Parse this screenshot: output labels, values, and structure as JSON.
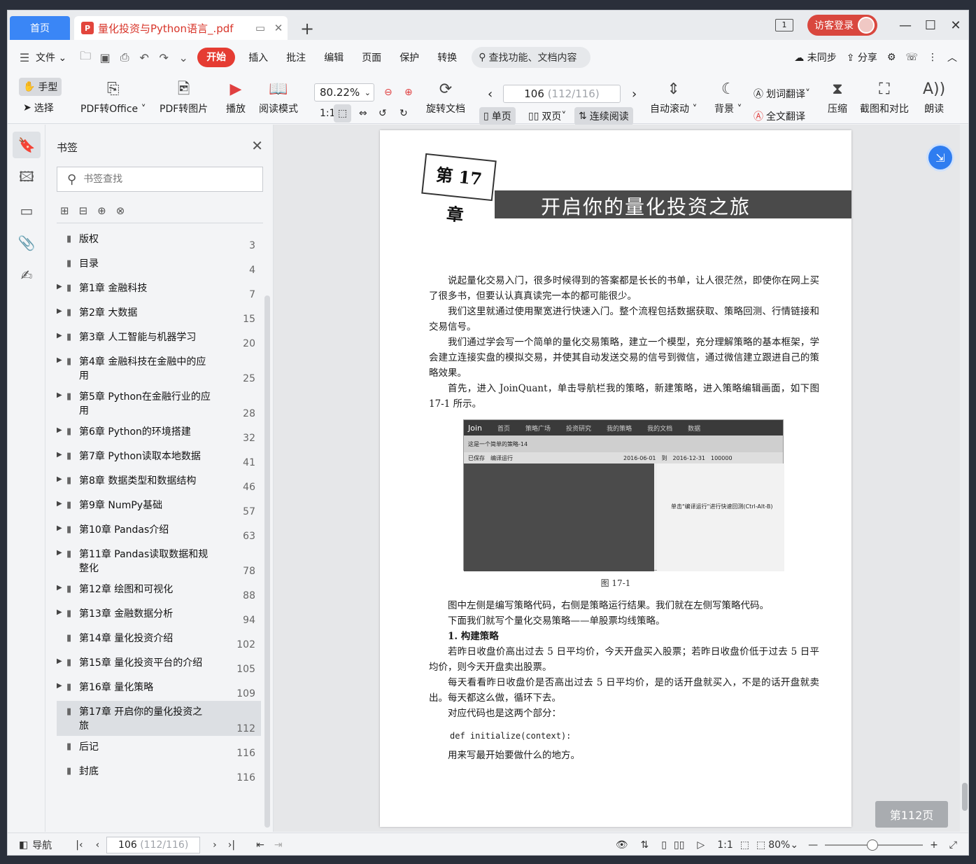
{
  "tabs": {
    "home": "首页",
    "doc_title": "量化投资与Python语言_.pdf"
  },
  "titlebar": {
    "screen_badge": "1",
    "login": "访客登录"
  },
  "menu": {
    "file": "文件",
    "items": [
      "开始",
      "插入",
      "批注",
      "编辑",
      "页面",
      "保护",
      "转换"
    ],
    "search": "查找功能、文档内容",
    "sync": "未同步",
    "share": "分享"
  },
  "toolbar": {
    "hand": "手型",
    "select": "选择",
    "pdf_office": "PDF转Office",
    "pdf_image": "PDF转图片",
    "play": "播放",
    "read_mode": "阅读模式",
    "zoom": "80.22%",
    "rotate": "旋转文档",
    "page_current": "106",
    "page_total": "(112/116)",
    "single": "单页",
    "double": "双页",
    "continuous": "连续阅读",
    "autoscroll": "自动滚动",
    "background": "背景",
    "word_translate": "划词翻译",
    "full_translate": "全文翻译",
    "compress": "压缩",
    "screenshot_compare": "截图和对比",
    "read_aloud": "朗读"
  },
  "bookmarks": {
    "title": "书签",
    "search_placeholder": "书签查找",
    "items": [
      {
        "label": "版权",
        "page": "3",
        "expandable": false,
        "selected": false
      },
      {
        "label": "目录",
        "page": "4",
        "expandable": false,
        "selected": false
      },
      {
        "label": "第1章 金融科技",
        "page": "7",
        "expandable": true,
        "selected": false
      },
      {
        "label": "第2章 大数据",
        "page": "15",
        "expandable": true,
        "selected": false
      },
      {
        "label": "第3章 人工智能与机器学习",
        "page": "20",
        "expandable": true,
        "selected": false
      },
      {
        "label": "第4章 金融科技在金融中的应用",
        "page": "25",
        "expandable": true,
        "selected": false
      },
      {
        "label": "第5章 Python在金融行业的应用",
        "page": "28",
        "expandable": true,
        "selected": false
      },
      {
        "label": "第6章 Python的环境搭建",
        "page": "32",
        "expandable": true,
        "selected": false
      },
      {
        "label": "第7章 Python读取本地数据",
        "page": "41",
        "expandable": true,
        "selected": false
      },
      {
        "label": "第8章 数据类型和数据结构",
        "page": "46",
        "expandable": true,
        "selected": false
      },
      {
        "label": "第9章 NumPy基础",
        "page": "57",
        "expandable": true,
        "selected": false
      },
      {
        "label": "第10章 Pandas介绍",
        "page": "63",
        "expandable": true,
        "selected": false
      },
      {
        "label": "第11章 Pandas读取数据和规整化",
        "page": "78",
        "expandable": true,
        "selected": false
      },
      {
        "label": "第12章 绘图和可视化",
        "page": "88",
        "expandable": true,
        "selected": false
      },
      {
        "label": "第13章 金融数据分析",
        "page": "94",
        "expandable": true,
        "selected": false
      },
      {
        "label": "第14章 量化投资介绍",
        "page": "102",
        "expandable": false,
        "selected": false
      },
      {
        "label": "第15章 量化投资平台的介绍",
        "page": "105",
        "expandable": true,
        "selected": false
      },
      {
        "label": "第16章 量化策略",
        "page": "109",
        "expandable": true,
        "selected": false
      },
      {
        "label": "第17章 开启你的量化投资之旅",
        "page": "112",
        "expandable": false,
        "selected": true
      },
      {
        "label": "后记",
        "page": "116",
        "expandable": false,
        "selected": false
      },
      {
        "label": "封底",
        "page": "116",
        "expandable": false,
        "selected": false
      }
    ]
  },
  "page": {
    "chapter_num": "第 17 章",
    "chapter_title": "开启你的量化投资之旅",
    "p1": "说起量化交易入门，很多时候得到的答案都是长长的书单，让人很茫然，即使你在网上买了很多书，但要认认真真读完一本的都可能很少。",
    "p2": "我们这里就通过使用聚宽进行快速入门。整个流程包括数据获取、策略回测、行情链接和交易信号。",
    "p3": "我们通过学会写一个简单的量化交易策略，建立一个模型，充分理解策略的基本框架，学会建立连接实盘的模拟交易，并使其自动发送交易的信号到微信，通过微信建立跟进自己的策略效果。",
    "p4": "首先，进入 JoinQuant，单击导航栏我的策略，新建策略，进入策略编辑画面，如下图 17-1 所示。",
    "fig_nav": [
      "Join",
      "首页",
      "策略广场",
      "投资研究",
      "我的策略",
      "我的文档",
      "数据"
    ],
    "fig_strategy": "这是一个简单的策略-14",
    "fig_save": "已保存",
    "fig_run": "编译运行",
    "fig_start": "2016-06-01",
    "fig_to": "到",
    "fig_end": "2016-12-31",
    "fig_cash": "100000",
    "fig_hint": "单击\"编译运行\"进行快速回测(Ctrl-Alt-B)",
    "fig_caption": "图    17-1",
    "p5": "图中左侧是编写策略代码，右侧是策略运行结果。我们就在左侧写策略代码。",
    "p6": "下面我们就写个量化交易策略——单股票均线策略。",
    "h1": "1. 构建策略",
    "p7": "若昨日收盘价高出过去 5 日平均价，今天开盘买入股票；若昨日收盘价低于过去 5 日平均价，则今天开盘卖出股票。",
    "p8": "每天看看昨日收盘价是否高出过去 5 日平均价，是的话开盘就买入，不是的话开盘就卖出。每天都这么做，循环下去。",
    "p9": "对应代码也是这两个部分：",
    "code1": "def initialize(context):",
    "p10": "用来写最开始要做什么的地方。"
  },
  "page_tag": "第112页",
  "statusbar": {
    "nav": "导航",
    "page_current": "106",
    "page_total": "(112/116)",
    "zoom": "80%"
  },
  "colors": {
    "accent": "#3a86f6",
    "brand_red": "#e53c33"
  }
}
